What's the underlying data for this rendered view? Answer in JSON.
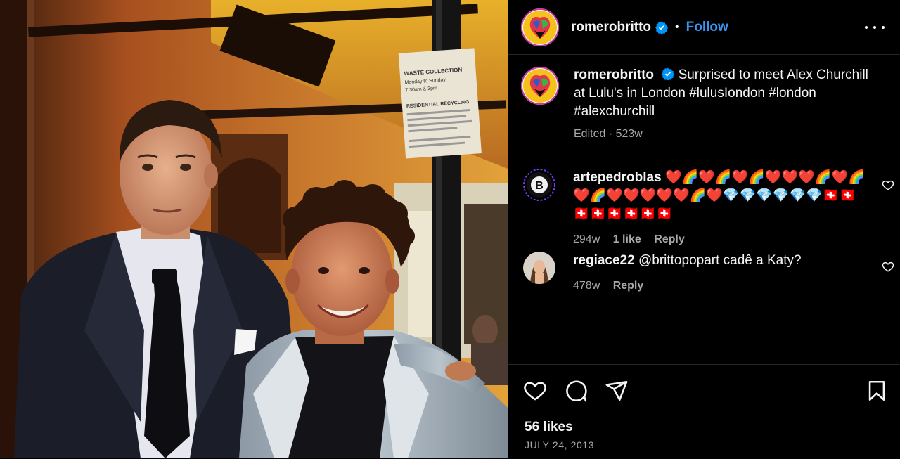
{
  "post": {
    "author": "romerobritto",
    "separator": "•",
    "follow_label": "Follow",
    "more_icon": "more-horizontal-icon",
    "photo_sign": {
      "line1": "WASTE COLLECTION",
      "line2": "Monday to Sunday",
      "line3": "7.30am & 3pm",
      "line4": "RESIDENTIAL RECYCLING"
    }
  },
  "caption": {
    "username": "romerobritto",
    "text": "Surprised to meet Alex Churchill at Lulu's in London #lulusIondon #london #alexchurchill",
    "meta": "Edited · 523w"
  },
  "comments": [
    {
      "username": "artepedroblas",
      "text": "❤️🌈❤️🌈❤️🌈❤️❤️❤️🌈❤️🌈❤️🌈❤️❤️❤️❤️❤️🌈❤️💎💎💎💎💎💎🇨🇭🇨🇭🇨🇭🇨🇭🇨🇭🇨🇭🇨🇭🇨🇭",
      "age": "294w",
      "likes": "1 like",
      "reply": "Reply"
    },
    {
      "username": "regiace22",
      "text": "@brittopopart cadê a Katy?",
      "age": "478w",
      "reply": "Reply"
    }
  ],
  "footer": {
    "likes": "56 likes",
    "date": "JULY 24, 2013"
  },
  "colors": {
    "link": "#3897f0",
    "muted": "#a8a8a8",
    "divider": "#262626"
  }
}
